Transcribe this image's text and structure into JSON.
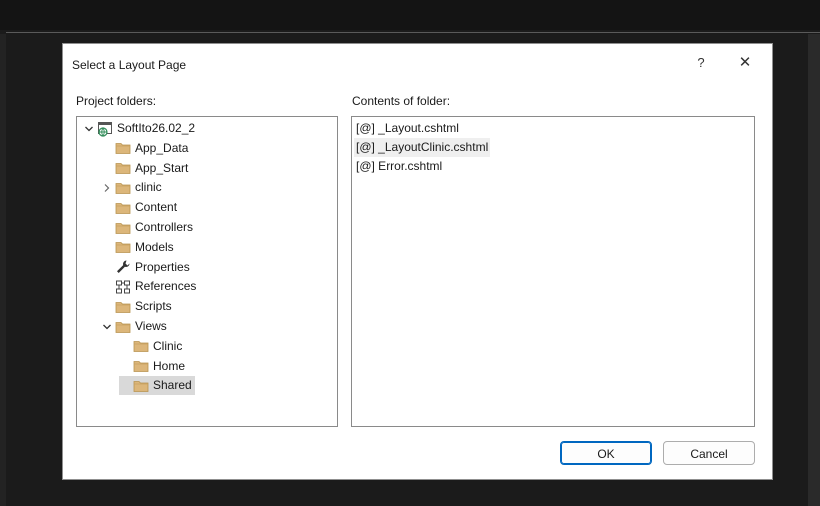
{
  "dialog": {
    "title": "Select a Layout Page",
    "help_label": "?",
    "close_label": "✕"
  },
  "project_folders": {
    "label": "Project folders:",
    "items": [
      {
        "label": "SoftIto26.02_2",
        "icon": "web-project-icon",
        "expander": "expanded"
      },
      {
        "label": "App_Data",
        "icon": "folder-icon",
        "expander": "none"
      },
      {
        "label": "App_Start",
        "icon": "folder-icon",
        "expander": "none"
      },
      {
        "label": "clinic",
        "icon": "folder-icon",
        "expander": "collapsed"
      },
      {
        "label": "Content",
        "icon": "folder-icon",
        "expander": "none"
      },
      {
        "label": "Controllers",
        "icon": "folder-icon",
        "expander": "none"
      },
      {
        "label": "Models",
        "icon": "folder-icon",
        "expander": "none"
      },
      {
        "label": "Properties",
        "icon": "wrench-icon",
        "expander": "none"
      },
      {
        "label": "References",
        "icon": "references-icon",
        "expander": "none"
      },
      {
        "label": "Scripts",
        "icon": "folder-icon",
        "expander": "none"
      },
      {
        "label": "Views",
        "icon": "folder-icon",
        "expander": "expanded"
      },
      {
        "label": "Clinic",
        "icon": "folder-icon",
        "expander": "none"
      },
      {
        "label": "Home",
        "icon": "folder-icon",
        "expander": "none"
      },
      {
        "label": "Shared",
        "icon": "folder-icon",
        "expander": "none",
        "selected": true
      }
    ]
  },
  "folder_contents": {
    "label": "Contents of folder:",
    "files": [
      {
        "label": "[@] _Layout.cshtml"
      },
      {
        "label": "[@] _LayoutClinic.cshtml",
        "hovered": true
      },
      {
        "label": "[@] Error.cshtml"
      }
    ]
  },
  "buttons": {
    "ok": "OK",
    "cancel": "Cancel"
  },
  "colors": {
    "folder": "#dcb67a",
    "selection": "#d9d9d9",
    "ok_border": "#0067c0",
    "project_icon": "#2e8b57"
  }
}
